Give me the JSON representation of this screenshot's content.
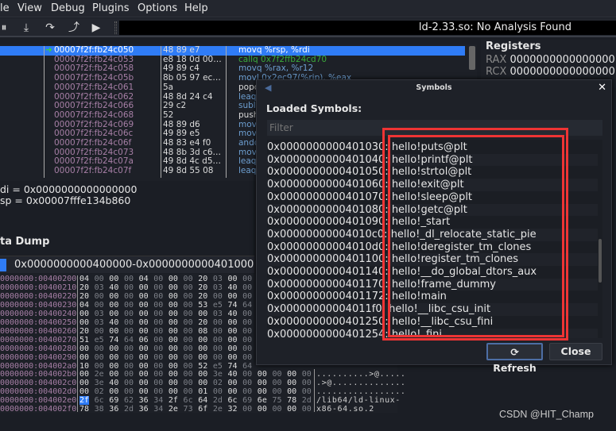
{
  "menu": [
    "le",
    "View",
    "Debug",
    "Plugins",
    "Options",
    "Help"
  ],
  "toolbar": {
    "icons": [
      "pause-icon",
      "step-into-icon",
      "step-over-icon",
      "step-out-icon",
      "run-icon"
    ],
    "analysis": "ld-2.33.so: No Analysis Found"
  },
  "disasm": {
    "rows": [
      {
        "addr": "00007f2f:fb24c050",
        "bytes": "48 89 e7",
        "ins": "movq %rsp, %rdi"
      },
      {
        "addr": "00007f2f:fb24c053",
        "bytes": "e8 18 0d 00…",
        "ins": "callq 0x7f2ffb24cd70"
      },
      {
        "addr": "00007f2f:fb24c058",
        "bytes": "49 89 c4",
        "ins": "movq %rax, %r12"
      },
      {
        "addr": "00007f2f:fb24c05b",
        "bytes": "8b 05 97 ec…",
        "ins": "movl 0x2ec97(%rip), %eax"
      },
      {
        "addr": "00007f2f:fb24c061",
        "bytes": "5a",
        "ins": "popq"
      },
      {
        "addr": "00007f2f:fb24c062",
        "bytes": "48 8d 24 c4",
        "ins": "leaq"
      },
      {
        "addr": "00007f2f:fb24c066",
        "bytes": "29 c2",
        "ins": "subl"
      },
      {
        "addr": "00007f2f:fb24c068",
        "bytes": "52",
        "ins": "pushq"
      },
      {
        "addr": "00007f2f:fb24c069",
        "bytes": "48 89 d6",
        "ins": "movq"
      },
      {
        "addr": "00007f2f:fb24c06c",
        "bytes": "49 89 e5",
        "ins": "movq"
      },
      {
        "addr": "00007f2f:fb24c06f",
        "bytes": "48 83 e4 f0",
        "ins": "andq"
      },
      {
        "addr": "00007f2f:fb24c073",
        "bytes": "48 8b 3d c6…",
        "ins": "movq"
      },
      {
        "addr": "00007f2f:fb24c07a",
        "bytes": "49 8d 4c d5…",
        "ins": "leaq"
      },
      {
        "addr": "00007f2f:fb24c07f",
        "bytes": "49 8d 55 08",
        "ins": "leaq"
      }
    ]
  },
  "registers": {
    "title": "Registers",
    "items": [
      {
        "name": "RAX",
        "value": "0000000000000000"
      },
      {
        "name": "RCX",
        "value": "0000000000000000"
      }
    ]
  },
  "reg_values": [
    "di = 0x0000000000000000",
    "sp = 0x00007fffe134b860"
  ],
  "dump": {
    "title": "ta Dump",
    "tab": "0x0000000000400000-0x0000000000401000",
    "rows": [
      {
        "addr": "0000000:00400200",
        "bytes": "04 00 00 00 04 00 00 00 20 03 00 00"
      },
      {
        "addr": "0000000:00400210",
        "bytes": "20 03 40 00 00 00 00 00 20 03 40 00"
      },
      {
        "addr": "0000000:00400220",
        "bytes": "20 00 00 00 00 00 00 00 20 00 00 00"
      },
      {
        "addr": "0000000:00400230",
        "bytes": "04 00 00 00 00 00 00 00 53 e5 74 64"
      },
      {
        "addr": "0000000:00400240",
        "bytes": "00 03 00 00 00 00 00 00 00 03 40 00"
      },
      {
        "addr": "0000000:00400250",
        "bytes": "00 03 40 00 00 00 00 00 20 00 00 00"
      },
      {
        "addr": "0000000:00400260",
        "bytes": "20 00 00 00 00 00 00 00 08 00 00 00"
      },
      {
        "addr": "0000000:00400270",
        "bytes": "51 e5 74 64 06 00 00 00 00 00 00 00"
      },
      {
        "addr": "0000000:00400280",
        "bytes": "00 00 00 00 00 00 00 00 00 00 00 00"
      },
      {
        "addr": "0000000:00400290",
        "bytes": "00 00 00 00 00 00 00 00 00 00 00 00"
      },
      {
        "addr": "0000000:004002a0",
        "bytes": "10 00 00 00 00 00 00 00 52 e5 74 64"
      },
      {
        "addr": "0000000:004002b0",
        "bytes": "00 2e 00 00 00 00 00 00 00 3e 40 00 00 00 00 00",
        "ascii": "..........>@....."
      },
      {
        "addr": "0000000:004002c0",
        "bytes": "00 3e 40 00 00 00 00 00 00 02 00 00 00 00 00 00",
        "ascii": ".>@.............."
      },
      {
        "addr": "0000000:004002d0",
        "bytes": "00 02 00 00 00 00 00 00 01 00 00 00 00 00 00 00",
        "ascii": "................."
      },
      {
        "addr": "0000000:004002e0",
        "bytes": "2f 6c 69 62 36 34 2f 6c 64 2d 6c 69 6e 75 78 2d",
        "ascii": "/lib64/ld-linux-"
      },
      {
        "addr": "0000000:004002f0",
        "bytes": "78 38 36 2d 36 34 2e 73 6f 2e 32 00 00 00 00 00",
        "ascii": "x86-64.so.2"
      }
    ]
  },
  "dialog": {
    "title": "Symbols",
    "label": "Loaded Symbols:",
    "filter_placeholder": "Filter",
    "symbols": [
      "0x0000000000401030: hello!puts@plt",
      "0x0000000000401040: hello!printf@plt",
      "0x0000000000401050: hello!strtol@plt",
      "0x0000000000401060: hello!exit@plt",
      "0x0000000000401070: hello!sleep@plt",
      "0x0000000000401080: hello!getc@plt",
      "0x0000000000401090: hello!_start",
      "0x00000000004010c0: hello!_dl_relocate_static_pie",
      "0x00000000004010d0: hello!deregister_tm_clones",
      "0x0000000000401100: hello!register_tm_clones",
      "0x0000000000401140: hello!__do_global_dtors_aux",
      "0x0000000000401170: hello!frame_dummy",
      "0x0000000000401172: hello!main",
      "0x00000000004011f0: hello!__libc_csu_init",
      "0x0000000000401250: hello!__libc_csu_fini",
      "0x0000000000401254: hello!_fini"
    ],
    "refresh": "Refresh",
    "close": "Close",
    "highlight_color": "#ee3434"
  },
  "watermark": "CSDN @HIT_Champ",
  "colors": {
    "selection": "#2f7cf6",
    "address": "#a77fa6"
  }
}
